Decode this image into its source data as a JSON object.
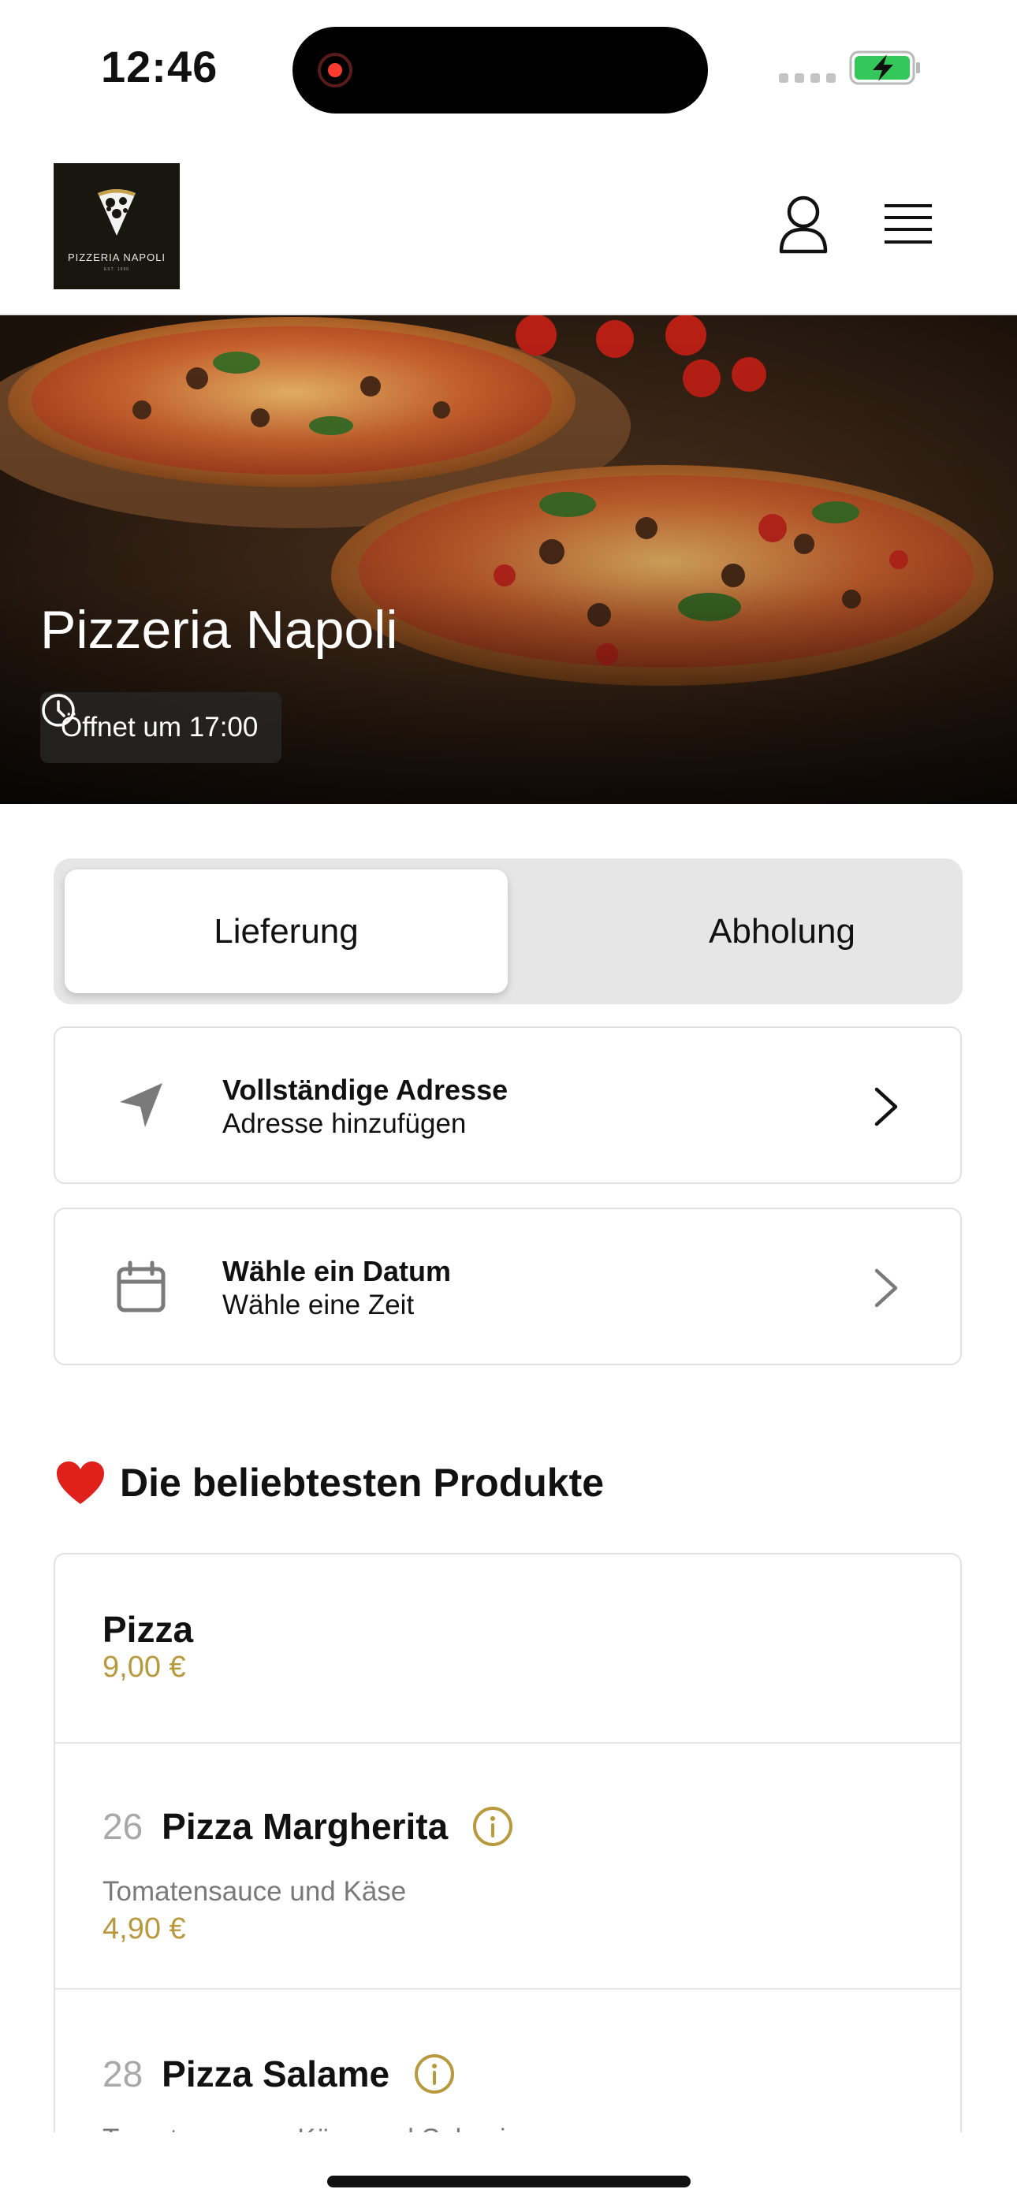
{
  "status_bar": {
    "time": "12:46"
  },
  "header": {
    "logo_text": "PIZZERIA NAPOLI",
    "logo_subtext": "EST. 1990"
  },
  "hero": {
    "title": "Pizzeria Napoli",
    "hours": "Öffnet um 17:00"
  },
  "order_mode": {
    "options": [
      "Lieferung",
      "Abholung"
    ],
    "selected": "Lieferung"
  },
  "address_card": {
    "title": "Vollständige Adresse",
    "subtitle": "Adresse hinzufügen"
  },
  "date_card": {
    "title": "Wähle ein Datum",
    "subtitle": "Wähle eine Zeit"
  },
  "popular": {
    "title": "Die beliebtesten Produkte",
    "category": {
      "name": "Pizza",
      "price": "9,00 €"
    },
    "items": [
      {
        "number": "26",
        "name": "Pizza Margherita",
        "description": "Tomatensauce und Käse",
        "price": "4,90 €"
      },
      {
        "number": "28",
        "name": "Pizza Salame",
        "description": "Tomatensauce, Käse und Salami",
        "price": ""
      }
    ]
  },
  "colors": {
    "accent_gold": "#b8993e",
    "recording_red": "#ff3b30",
    "battery_green": "#34c759"
  }
}
